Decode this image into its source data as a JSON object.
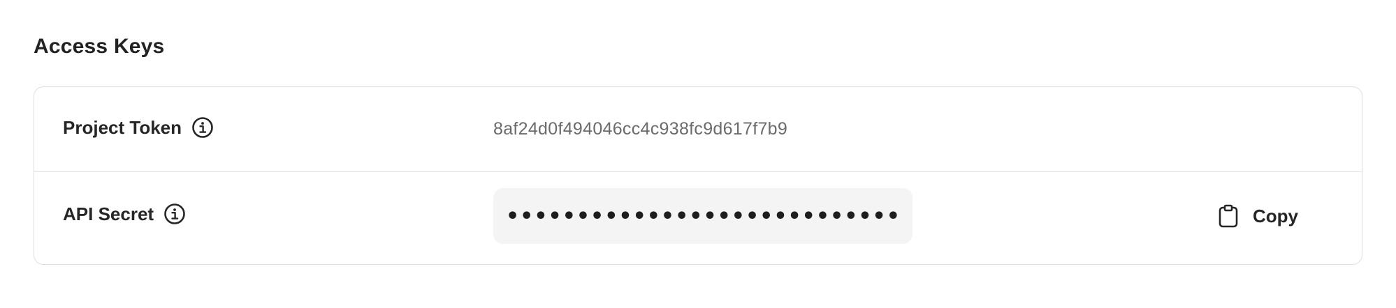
{
  "section": {
    "title": "Access Keys"
  },
  "rows": [
    {
      "label": "Project Token",
      "icon": "info-icon",
      "value": "8af24d0f494046cc4c938fc9d617f7b9"
    },
    {
      "label": "API Secret",
      "icon": "info-icon",
      "masked_value": "••••••••••••••••••••••••••••••••",
      "action": {
        "label": "Copy",
        "icon": "clipboard-icon"
      }
    }
  ]
}
